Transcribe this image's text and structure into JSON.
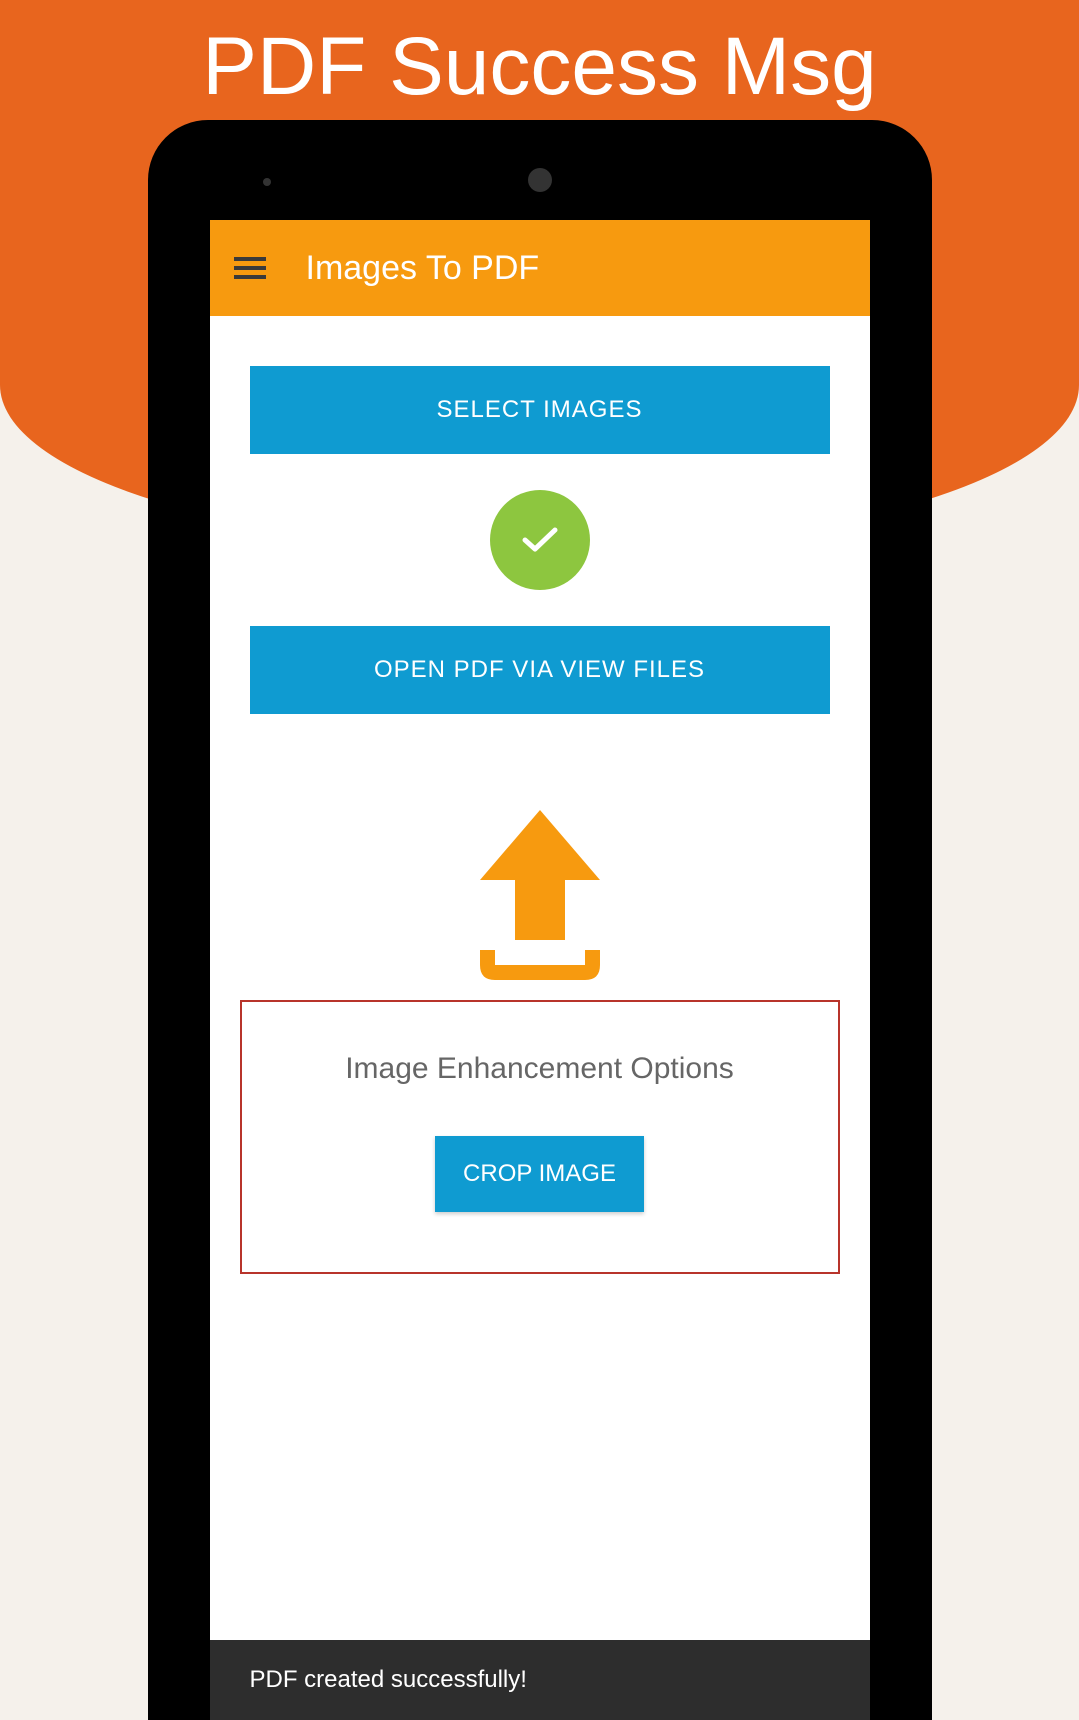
{
  "promo": {
    "title": "PDF Success Msg"
  },
  "appBar": {
    "title": "Images To PDF"
  },
  "buttons": {
    "selectImages": "SELECT IMAGES",
    "openPdf": "OPEN PDF VIA VIEW FILES",
    "cropImage": "CROP IMAGE"
  },
  "enhancement": {
    "title": "Image Enhancement Options"
  },
  "toast": {
    "message": "PDF created successfully!"
  }
}
